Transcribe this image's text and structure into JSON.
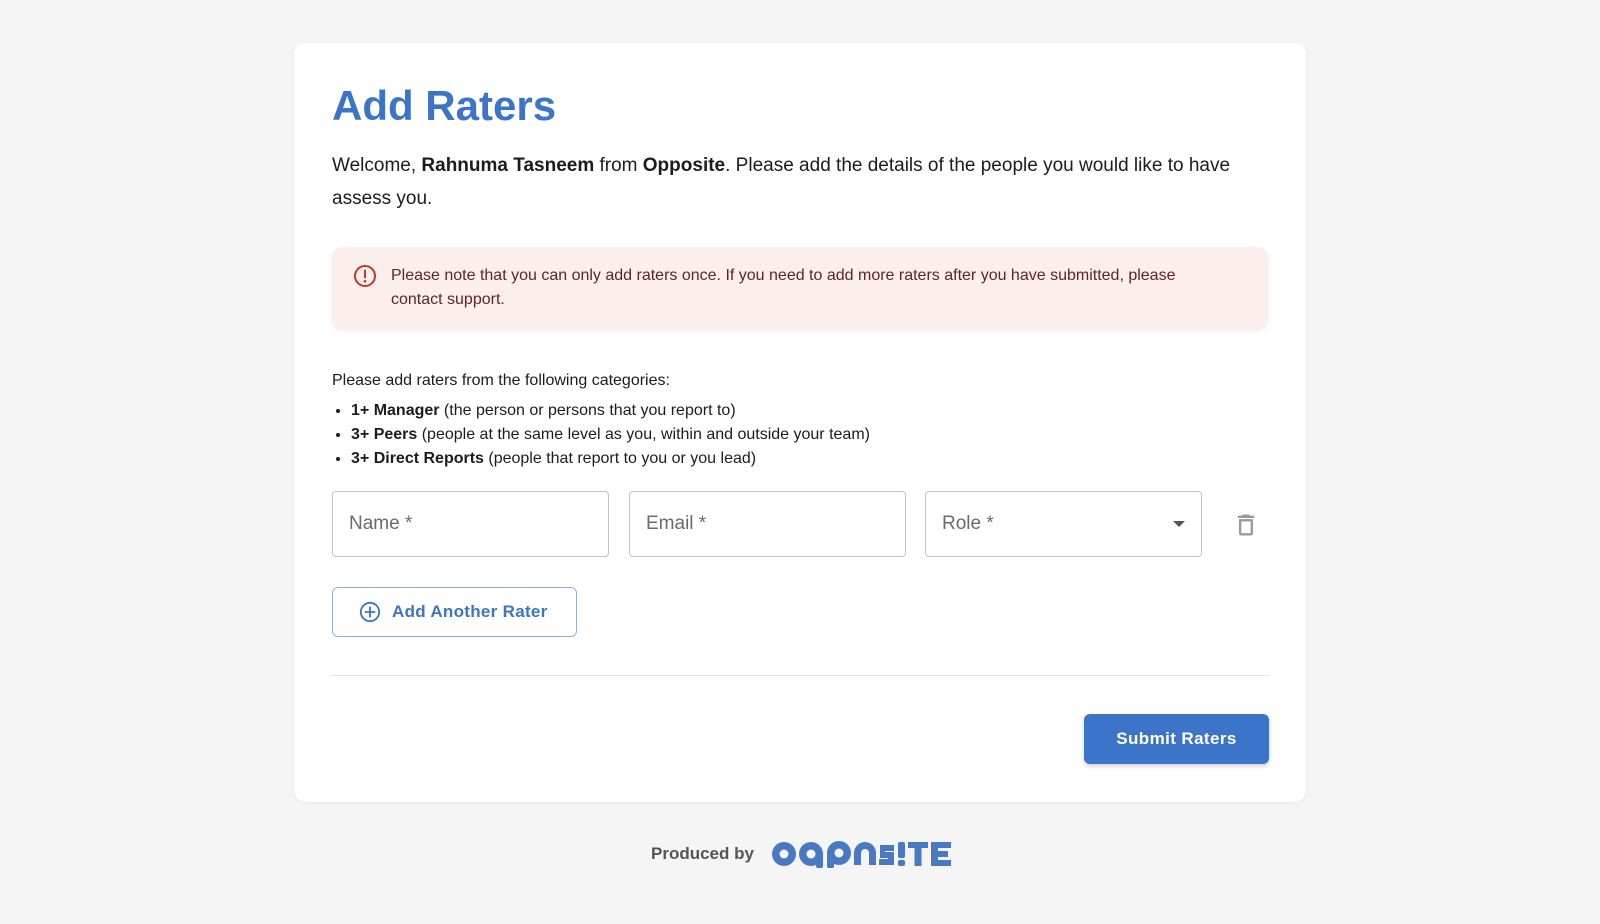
{
  "page": {
    "title": "Add Raters",
    "welcome": {
      "prefix": "Welcome, ",
      "user_name": "Rahnuma Tasneem",
      "middle": " from ",
      "company": "Opposite",
      "suffix": ". Please add the details of the people you would like to have assess you."
    },
    "alert": {
      "icon": "alert-circle-icon",
      "text": "Please note that you can only add raters once. If you need to add more raters after you have submitted, please contact support."
    },
    "categories": {
      "intro": "Please add raters from the following categories:",
      "items": [
        {
          "bold": "1+ Manager",
          "rest": " (the person or persons that you report to)"
        },
        {
          "bold": "3+ Peers",
          "rest": " (people at the same level as you, within and outside your team)"
        },
        {
          "bold": "3+ Direct Reports",
          "rest": " (people that report to you or you lead)"
        }
      ]
    },
    "form": {
      "name_placeholder": "Name *",
      "name_value": "",
      "email_placeholder": "Email *",
      "email_value": "",
      "role_label": "Role *",
      "role_value": "",
      "delete_icon": "trash-icon"
    },
    "add_button": {
      "label": "Add Another Rater",
      "icon": "plus-circle-icon"
    },
    "submit_button": {
      "label": "Submit Raters"
    },
    "footer": {
      "produced_by": "Produced by",
      "logo_text": "OPPOSITE"
    }
  },
  "colors": {
    "accent": "#3b74c8",
    "alert_bg": "#fbeeed",
    "alert_icon": "#c0392b",
    "page_bg": "#f5f5f5"
  }
}
